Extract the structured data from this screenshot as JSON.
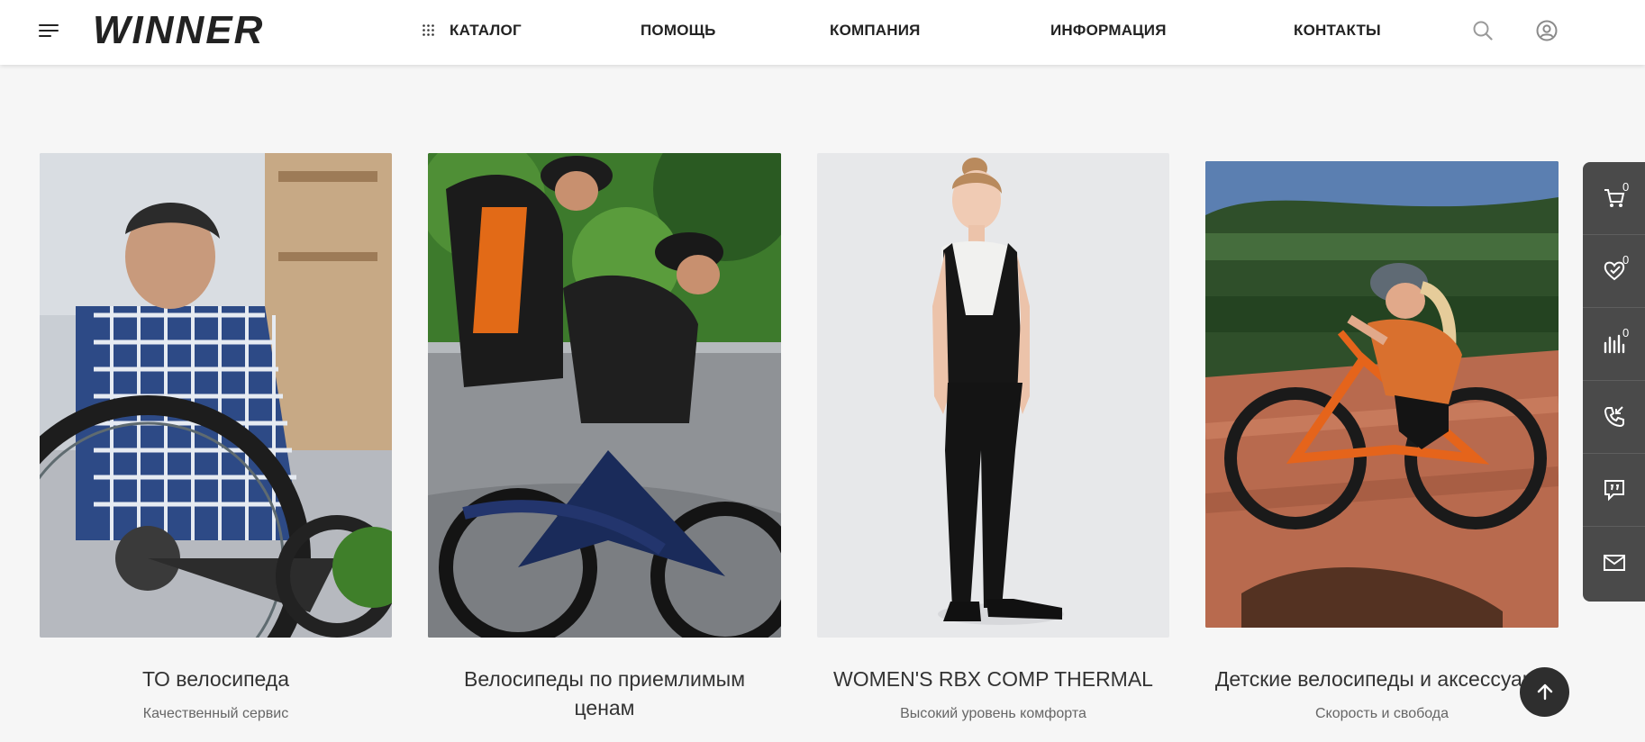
{
  "header": {
    "logo_text": "WINNER",
    "nav": [
      {
        "label": "КАТАЛОГ"
      },
      {
        "label": "ПОМОЩЬ"
      },
      {
        "label": "КОМПАНИЯ"
      },
      {
        "label": "ИНФОРМАЦИЯ"
      },
      {
        "label": "КОНТАКТЫ"
      }
    ],
    "icons": [
      "menu-icon",
      "grid-icon",
      "search-icon",
      "user-icon"
    ]
  },
  "cards": [
    {
      "title": "ТО велосипеда",
      "subtitle": "Качественный сервис"
    },
    {
      "title": "Велосипеды по приемлимым ценам",
      "subtitle": ""
    },
    {
      "title": "WOMEN'S RBX COMP THERMAL",
      "subtitle": "Высокий уровень комфорта"
    },
    {
      "title": "Детские велосипеды и аксессуары",
      "subtitle": "Скорость и свобода"
    }
  ],
  "side_panel": {
    "cart_count": "0",
    "favorites_count": "0",
    "compare_count": "0",
    "icons": [
      "cart-icon",
      "heart-icon",
      "compare-icon",
      "callback-icon",
      "chat-icon",
      "mail-icon"
    ]
  },
  "colors": {
    "page_bg": "#f6f6f6",
    "header_bg": "#ffffff",
    "side_panel_bg": "#4a4a4a",
    "scroll_top_bg": "#2e2e2e"
  }
}
